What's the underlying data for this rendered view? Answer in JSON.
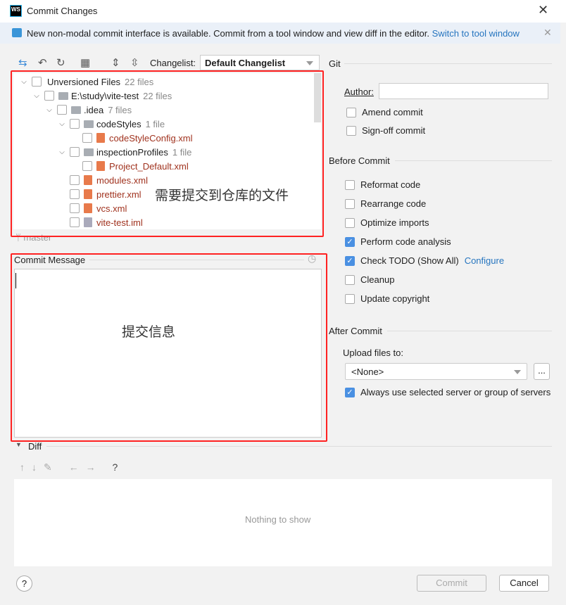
{
  "window": {
    "title": "Commit Changes",
    "logo": "WS"
  },
  "banner": {
    "text": "New non-modal commit interface is available. Commit from a tool window and view diff in the editor.",
    "link": "Switch to tool window"
  },
  "toolbar": {
    "changelist_label": "Changelist:",
    "changelist_value": "Default Changelist"
  },
  "tree": [
    {
      "label": "Unversioned Files",
      "count": "22 files",
      "level": 0,
      "type": "group",
      "expanded": true
    },
    {
      "label": "E:\\study\\vite-test",
      "count": "22 files",
      "level": 1,
      "type": "folder",
      "expanded": true
    },
    {
      "label": ".idea",
      "count": "7 files",
      "level": 2,
      "type": "folder",
      "expanded": true
    },
    {
      "label": "codeStyles",
      "count": "1 file",
      "level": 3,
      "type": "folder",
      "expanded": true
    },
    {
      "label": "codeStyleConfig.xml",
      "count": "",
      "level": 4,
      "type": "xml"
    },
    {
      "label": "inspectionProfiles",
      "count": "1 file",
      "level": 3,
      "type": "folder",
      "expanded": true
    },
    {
      "label": "Project_Default.xml",
      "count": "",
      "level": 4,
      "type": "xml"
    },
    {
      "label": "modules.xml",
      "count": "",
      "level": 3,
      "type": "xml"
    },
    {
      "label": "prettier.xml",
      "count": "",
      "level": 3,
      "type": "xml"
    },
    {
      "label": "vcs.xml",
      "count": "",
      "level": 3,
      "type": "xml"
    },
    {
      "label": "vite-test.iml",
      "count": "",
      "level": 3,
      "type": "iml"
    }
  ],
  "branch": "master",
  "annotations": {
    "files": "需要提交到仓库的文件",
    "message": "提交信息"
  },
  "commit_message": {
    "label": "Commit Message",
    "value": ""
  },
  "git": {
    "title": "Git",
    "author_label": "Author:",
    "author_value": "",
    "options": [
      {
        "label": "Amend commit",
        "checked": false
      },
      {
        "label": "Sign-off commit",
        "checked": false
      }
    ]
  },
  "before_commit": {
    "title": "Before Commit",
    "options": [
      {
        "label": "Reformat code",
        "checked": false
      },
      {
        "label": "Rearrange code",
        "checked": false
      },
      {
        "label": "Optimize imports",
        "checked": false
      },
      {
        "label": "Perform code analysis",
        "checked": true
      },
      {
        "label": "Check TODO (Show All)",
        "checked": true,
        "link": "Configure"
      },
      {
        "label": "Cleanup",
        "checked": false
      },
      {
        "label": "Update copyright",
        "checked": false
      }
    ]
  },
  "after_commit": {
    "title": "After Commit",
    "upload_label": "Upload files to:",
    "upload_value": "<None>",
    "browse": "...",
    "always_label": "Always use selected server or group of servers",
    "always_checked": true
  },
  "diff": {
    "title": "Diff",
    "empty": "Nothing to show",
    "help": "?"
  },
  "footer": {
    "commit": "Commit",
    "cancel": "Cancel",
    "help": "?"
  },
  "colors": {
    "accent": "#4a90e2",
    "link": "#2675bf",
    "annotation": "#ff2222",
    "unversioned": "#a0321e"
  }
}
